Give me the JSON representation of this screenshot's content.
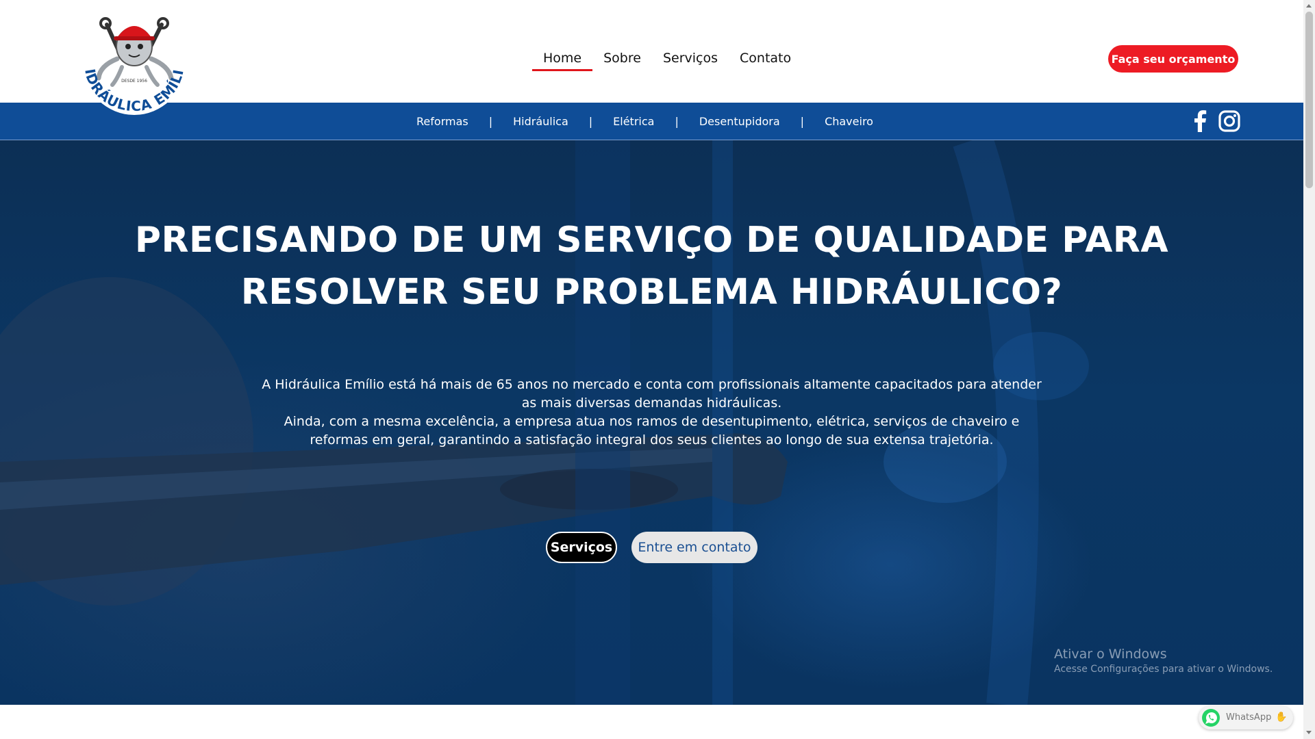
{
  "brand": {
    "logo_text": "HIDRÁULICA EMÍLIO",
    "logo_since": "DESDE 1956",
    "colors": {
      "red": "#ed1b24",
      "blue": "#0f4d97"
    }
  },
  "nav": {
    "items": [
      {
        "label": "Home",
        "active": true
      },
      {
        "label": "Sobre",
        "active": false
      },
      {
        "label": "Serviços",
        "active": false
      },
      {
        "label": "Contato",
        "active": false
      }
    ],
    "cta": "Faça seu orçamento"
  },
  "subnav": {
    "items": [
      "Reformas",
      "Hidráulica",
      "Elétrica",
      "Desentupidora",
      "Chaveiro"
    ],
    "separator": "|",
    "social": [
      "facebook-icon",
      "instagram-icon"
    ]
  },
  "hero": {
    "title_line1": "PRECISANDO DE UM SERVIÇO DE QUALIDADE PARA",
    "title_line2": "RESOLVER SEU PROBLEMA HIDRÁULICO?",
    "paragraph1": "A Hidráulica Emílio está há mais de 65 anos no mercado e conta com profissionais altamente capacitados para atender as mais diversas demandas hidráulicas.",
    "paragraph2": "Ainda, com a mesma excelência, a empresa atua nos ramos de desentupimento, elétrica, serviços de chaveiro e reformas em geral, garantindo a satisfação integral dos seus clientes ao longo de sua extensa trajetória.",
    "btn_services": "Serviços",
    "btn_contact": "Entre em contato"
  },
  "watermark": {
    "line1": "Ativar o Windows",
    "line2": "Acesse Configurações para ativar o Windows."
  },
  "whatsapp": {
    "label": "WhatsApp",
    "icon": "whatsapp-icon",
    "badge_icon": "hand-icon"
  }
}
